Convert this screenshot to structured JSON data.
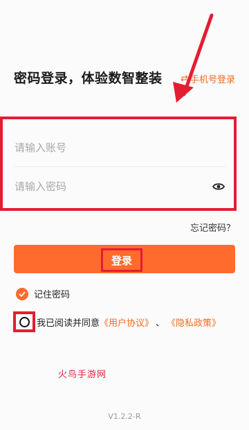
{
  "header": {
    "title": "密码登录，体验数智整装",
    "switch_link": "手机号登录",
    "switch_icon": "swap-arrows-icon"
  },
  "form": {
    "account_placeholder": "请输入账号",
    "password_placeholder": "请输入密码",
    "password_toggle_icon": "eye-icon",
    "forgot_password": "忘记密码？"
  },
  "actions": {
    "login_label": "登录"
  },
  "options": {
    "remember_label": "记住密码",
    "remember_checked": true,
    "agree_prefix": "我已阅读并同意",
    "user_agreement": "《用户协议》",
    "separator": "、",
    "privacy_policy": "《隐私政策》",
    "agree_checked": false
  },
  "footer": {
    "watermark": "火鸟手游网",
    "version": "V1.2.2-R"
  },
  "colors": {
    "accent": "#fe6b2c",
    "link": "#f26b21",
    "annotation": "#e21e32"
  }
}
